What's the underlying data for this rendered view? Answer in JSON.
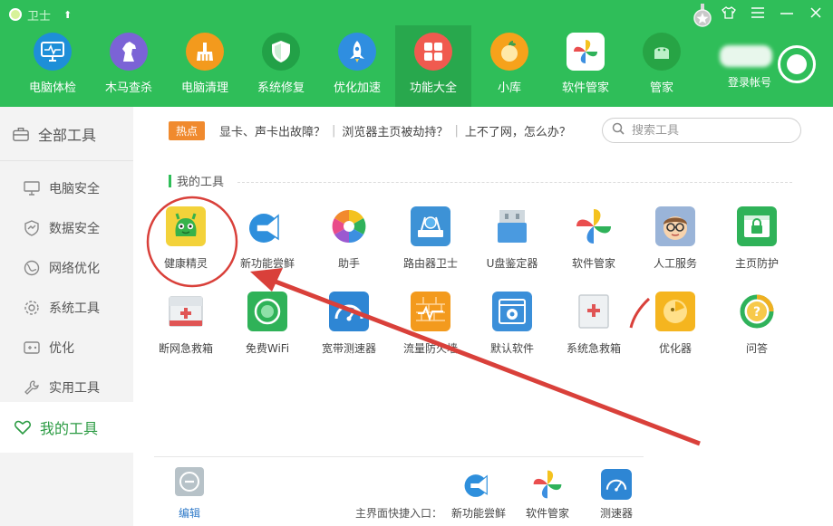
{
  "window": {
    "title": "卫士",
    "controls": [
      "shirt-icon",
      "menu-icon",
      "minimize-icon",
      "close-icon"
    ]
  },
  "nav": {
    "items": [
      {
        "label": "电脑体检",
        "icon": "monitor-check-icon",
        "color": "#1e8fd8"
      },
      {
        "label": "木马查杀",
        "icon": "horse-icon",
        "color": "#7b63d6"
      },
      {
        "label": "电脑清理",
        "icon": "broom-icon",
        "color": "#f39a1d"
      },
      {
        "label": "系统修复",
        "icon": "shield-icon",
        "color": "#22a147"
      },
      {
        "label": "优化加速",
        "icon": "rocket-icon",
        "color": "#2f8ee0"
      },
      {
        "label": "功能大全",
        "icon": "grid-icon",
        "color": "#f05a4f",
        "active": true
      },
      {
        "label": "小库",
        "icon": "apple-icon",
        "color": "#f6a21b"
      },
      {
        "label": "软件管家",
        "icon": "pinwheel-icon",
        "color": "#e9514b"
      },
      {
        "label": "管家",
        "icon": "android-icon",
        "color": "#27a445"
      }
    ]
  },
  "account": {
    "label": "登录帐号"
  },
  "sidebar": {
    "all_tools": "全部工具",
    "items": [
      {
        "label": "电脑安全",
        "icon": "pc-icon"
      },
      {
        "label": "数据安全",
        "icon": "chart-shield-icon"
      },
      {
        "label": "网络优化",
        "icon": "globe-icon"
      },
      {
        "label": "系统工具",
        "icon": "gear-icon"
      },
      {
        "label": "优化",
        "icon": "gamepad-icon"
      },
      {
        "label": "实用工具",
        "icon": "wrench-icon"
      }
    ],
    "my_tools": "我的工具"
  },
  "hot": {
    "badge": "热点",
    "links": [
      "显卡、声卡出故障？",
      "浏览器主页被劫持？",
      "上不了网，怎么办？"
    ]
  },
  "search": {
    "placeholder": "搜索工具"
  },
  "section": {
    "title": "我的工具"
  },
  "tools": [
    {
      "label": "健康精灵",
      "icon": "green-monster-icon",
      "color": "#f3d23a"
    },
    {
      "label": "新功能尝鲜",
      "icon": "megaphone-icon",
      "color": "#2e8fdc"
    },
    {
      "label": "助手",
      "icon": "color-wheel-icon",
      "color": "#e94b8a"
    },
    {
      "label": "路由器卫士",
      "icon": "router-icon",
      "color": "#3d92d6"
    },
    {
      "label": "U盘鉴定器",
      "icon": "usb-drive-icon",
      "color": "#4a9ae0"
    },
    {
      "label": "软件管家",
      "icon": "pinwheel-icon",
      "color": "#e9514b"
    },
    {
      "label": "人工服务",
      "icon": "glasses-face-icon",
      "color": "#9ab4d8"
    },
    {
      "label": "主页防护",
      "icon": "lock-page-icon",
      "color": "#2fb258"
    },
    {
      "label": "断网急救箱",
      "icon": "first-aid-box-icon",
      "color": "#e05555"
    },
    {
      "label": "免费WiFi",
      "icon": "wifi-icon",
      "color": "#2fb258"
    },
    {
      "label": "宽带测速器",
      "icon": "speedometer-icon",
      "color": "#2e86d4"
    },
    {
      "label": "流量防火墙",
      "icon": "firewall-icon",
      "color": "#f39a1d"
    },
    {
      "label": "默认软件",
      "icon": "settings-window-icon",
      "color": "#3b8fd9"
    },
    {
      "label": "系统急救箱",
      "icon": "first-aid-kit-icon",
      "color": "#e05555"
    },
    {
      "label": "优化器",
      "icon": "optimizer-icon",
      "color": "#f5b51f"
    },
    {
      "label": "问答",
      "icon": "question-ring-icon",
      "color": "#f0b021"
    }
  ],
  "bottom": {
    "edit_label": "编辑",
    "quick_label": "主界面快捷入口：",
    "quick_items": [
      {
        "label": "新功能尝鲜",
        "icon": "megaphone-icon"
      },
      {
        "label": "软件管家",
        "icon": "pinwheel-icon"
      },
      {
        "label": "测速器",
        "icon": "speedometer-icon"
      }
    ]
  }
}
